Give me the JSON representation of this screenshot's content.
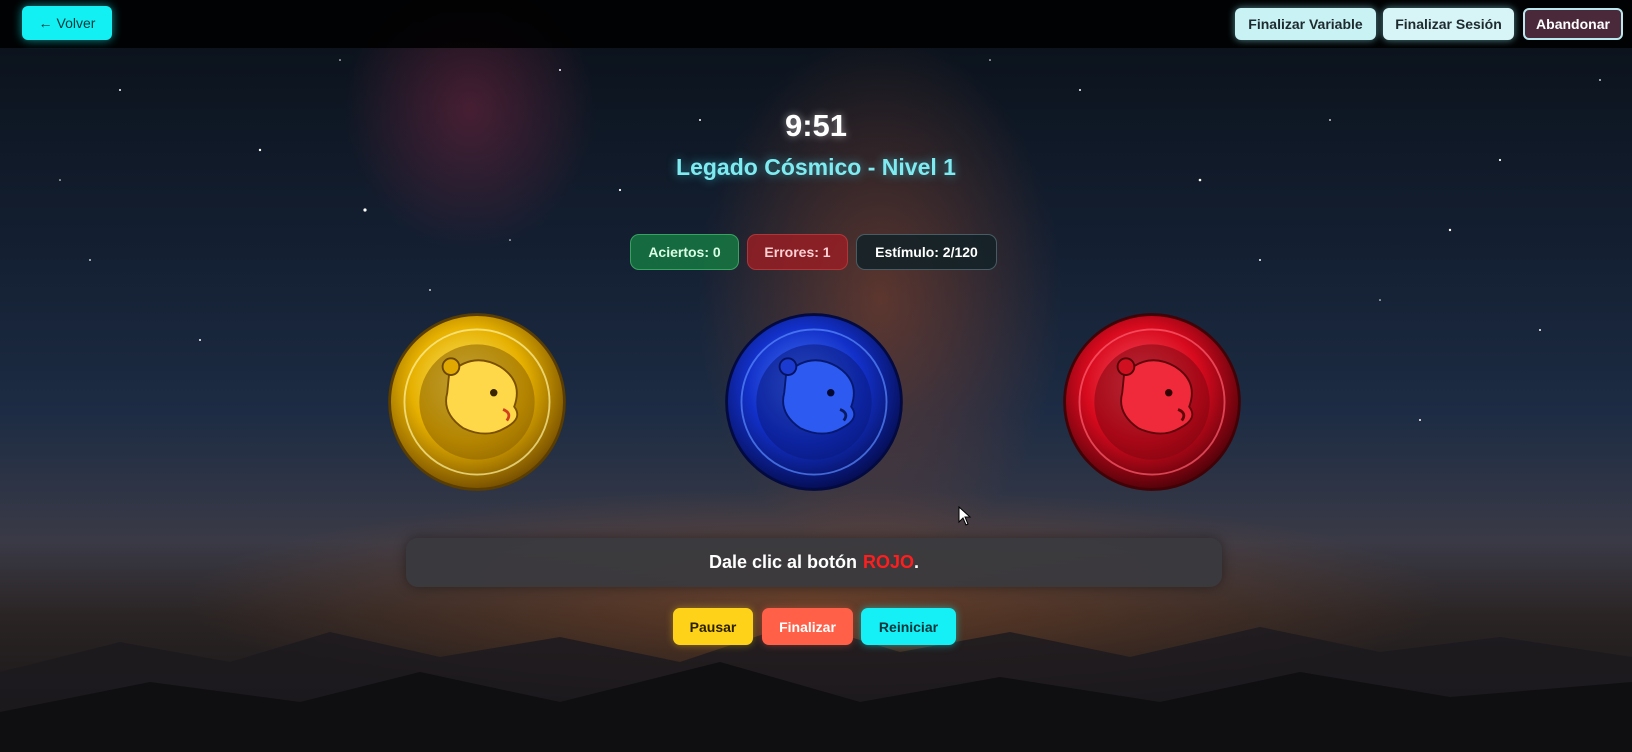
{
  "topbar": {
    "back_label": "Volver",
    "back_icon": "left-arrow-icon",
    "finish_variable_label": "Finalizar Variable",
    "finish_session_label": "Finalizar Sesión",
    "abandon_label": "Abandonar"
  },
  "game": {
    "timer": "9:51",
    "title": "Legado Cósmico - Nivel 1"
  },
  "stats": {
    "hits": "Aciertos: 0",
    "errors": "Errores: 1",
    "stimulus": "Estímulo: 2/120"
  },
  "coins": [
    {
      "color_name": "yellow",
      "color": "#f2c400",
      "icon": "lion-coin-icon"
    },
    {
      "color_name": "blue",
      "color": "#1a46ff",
      "icon": "lion-coin-icon"
    },
    {
      "color_name": "red",
      "color": "#ff1a2c",
      "icon": "lion-coin-icon"
    }
  ],
  "instruction": {
    "prefix": "Dale clic al botón",
    "color_word": "ROJO",
    "suffix": ".",
    "color_word_color": "#ff1e1e"
  },
  "controls": {
    "pause_label": "Pausar",
    "finish_label": "Finalizar",
    "restart_label": "Reiniciar"
  },
  "colors": {
    "accent_cyan": "#13f0f3",
    "pause_yellow": "#ffd21a",
    "finish_red": "#ff6047"
  }
}
